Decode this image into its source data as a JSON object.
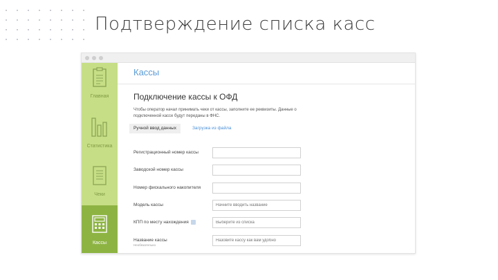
{
  "slide": {
    "title": "Подтверждение списка касс"
  },
  "app": {
    "colors": {
      "sidebar": "#c6de85",
      "sidebar_active": "#8db443",
      "link": "#5a9bd5"
    },
    "sidebar": {
      "items": [
        {
          "label": "Главная",
          "icon": "clipboard-icon"
        },
        {
          "label": "Статистика",
          "icon": "bar-chart-icon"
        },
        {
          "label": "Чеки",
          "icon": "receipt-icon"
        },
        {
          "label": "Кассы",
          "icon": "cash-register-icon",
          "active": true
        }
      ]
    },
    "page_title": "Кассы",
    "section_title": "Подключение кассы к ОФД",
    "description": "Чтобы оператор начал принимать чеки от кассы, заполните ее реквизиты. Данные о подключенной кассе будут переданы в ФНС.",
    "tabs": {
      "manual": "Ручной ввод данных",
      "file": "Загрузка из файла"
    },
    "fields": [
      {
        "label": "Регистрационный номер кассы",
        "value": "",
        "placeholder": ""
      },
      {
        "label": "Заводской номер кассы",
        "value": "",
        "placeholder": ""
      },
      {
        "label": "Номер фискального накопителя",
        "value": "",
        "placeholder": ""
      },
      {
        "label": "Модель кассы",
        "value": "",
        "placeholder": "Начните вводить название"
      },
      {
        "label": "КПП по месту нахождения",
        "value": "",
        "placeholder": "Выберите из списка"
      },
      {
        "label": "Название кассы",
        "sublabel": "Необязательно",
        "value": "",
        "placeholder": "Назовите кассу как вам удобно"
      }
    ]
  }
}
